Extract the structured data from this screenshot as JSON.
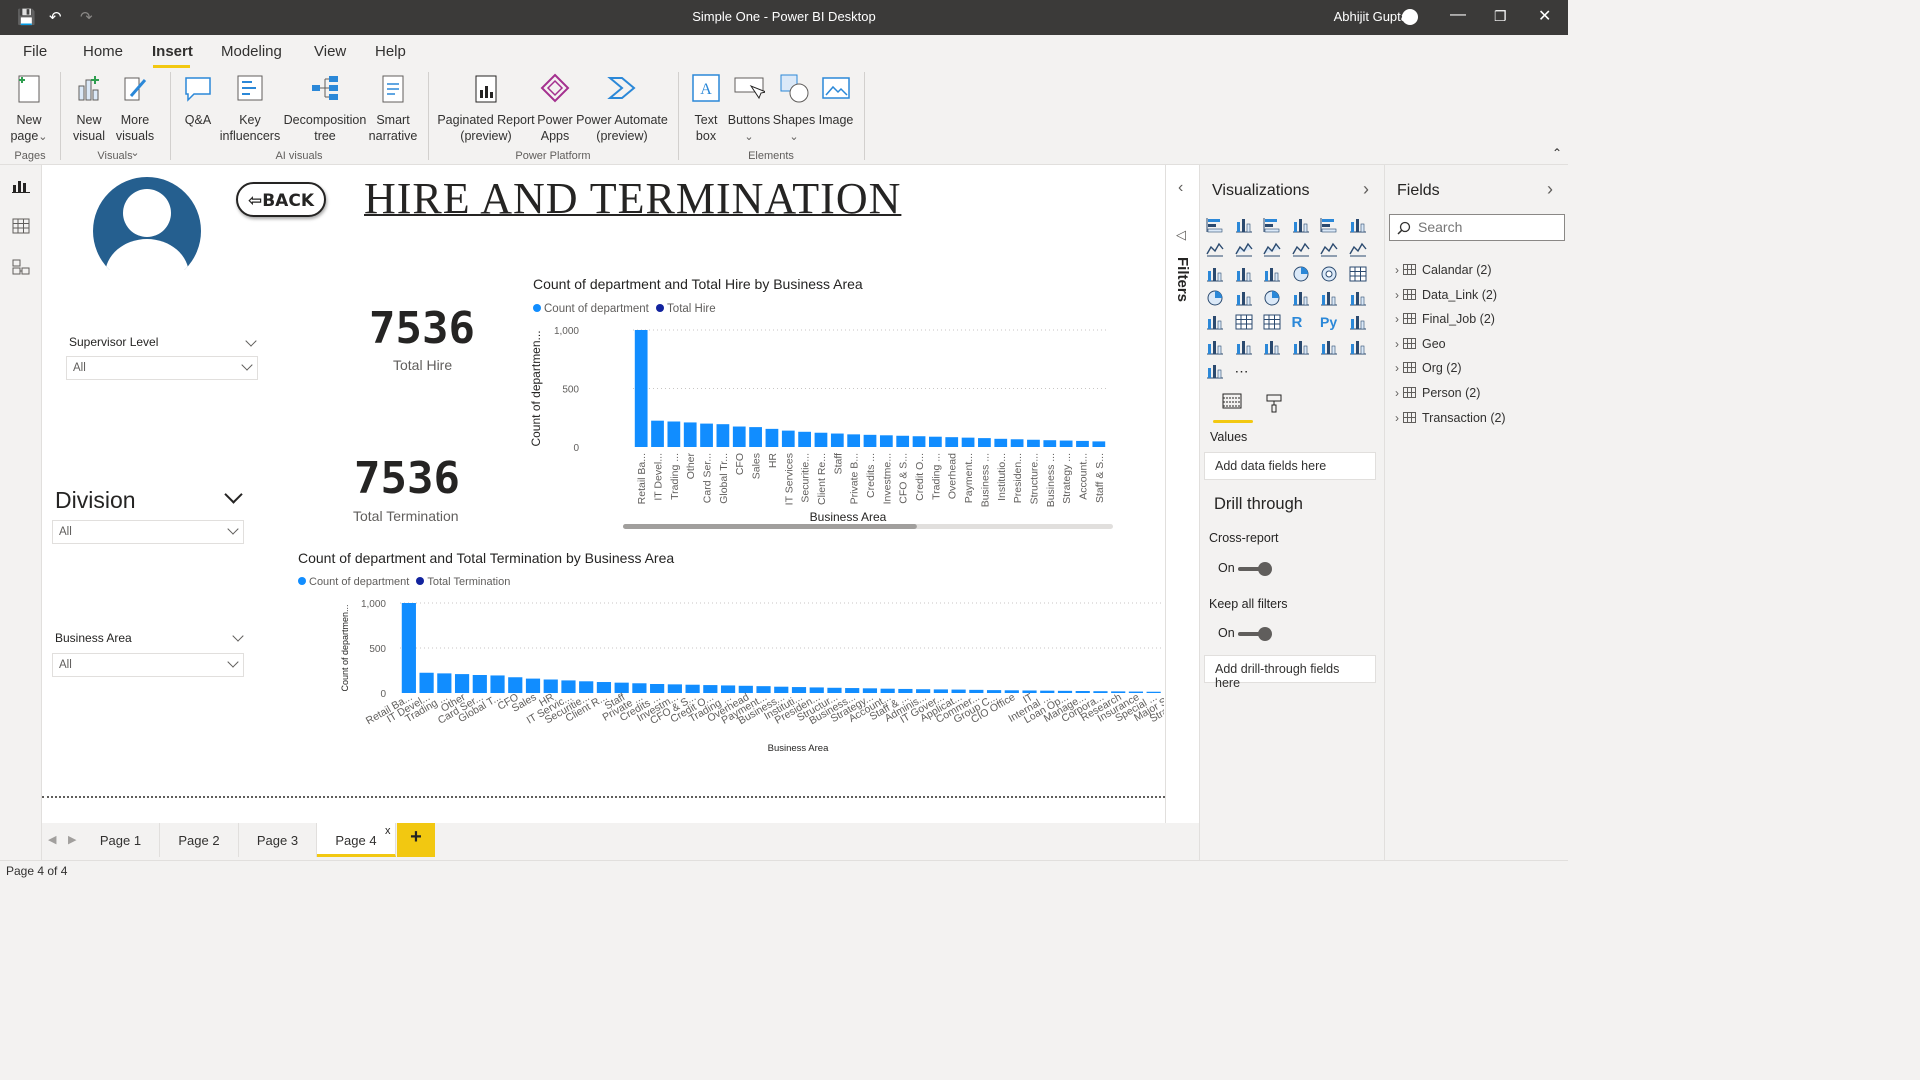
{
  "window": {
    "title": "Simple One - Power BI Desktop",
    "user": "Abhijit Gupta"
  },
  "menu": {
    "tabs": [
      "File",
      "Home",
      "Insert",
      "Modeling",
      "View",
      "Help"
    ],
    "active": "Insert"
  },
  "ribbon": {
    "buttons": {
      "new_page": [
        "New",
        "page"
      ],
      "new_visual": [
        "New",
        "visual"
      ],
      "more_visuals": [
        "More",
        "visuals"
      ],
      "qa": [
        "Q&A",
        ""
      ],
      "key_influencers": [
        "Key",
        "influencers"
      ],
      "decomposition_tree": [
        "Decomposition",
        "tree"
      ],
      "smart_narrative": [
        "Smart",
        "narrative"
      ],
      "paginated_report": [
        "Paginated Report",
        "(preview)"
      ],
      "power_apps": [
        "Power",
        "Apps"
      ],
      "power_automate": [
        "Power Automate",
        "(preview)"
      ],
      "text_box": [
        "Text",
        "box"
      ],
      "buttons": [
        "Buttons",
        ""
      ],
      "shapes": [
        "Shapes",
        ""
      ],
      "image": [
        "Image",
        ""
      ]
    },
    "groups": {
      "pages": "Pages",
      "visuals": "Visuals",
      "ai": "AI visuals",
      "platform": "Power Platform",
      "elements": "Elements"
    }
  },
  "canvas": {
    "back_button": "⇦BACK",
    "title": "HIRE AND TERMINATION",
    "card_hire": {
      "value": "7536",
      "label": "Total Hire"
    },
    "card_term": {
      "value": "7536",
      "label": "Total Termination"
    },
    "slicers": {
      "supervisor": {
        "label": "Supervisor Level",
        "value": "All"
      },
      "division": {
        "label": "Division",
        "value": "All"
      },
      "business_area": {
        "label": "Business Area",
        "value": "All"
      }
    }
  },
  "chart_data": [
    {
      "type": "bar",
      "title": "Count of department and Total Hire by Business Area",
      "legend": [
        "Count of department",
        "Total Hire"
      ],
      "xlabel": "Business Area",
      "ylabel": "Count of departmen...",
      "ylim": [
        0,
        1000
      ],
      "yticks": [
        "1,000",
        "500",
        "0"
      ],
      "categories": [
        "Retail Ba...",
        "IT Devel...",
        "Trading ...",
        "Other",
        "Card Ser...",
        "Global Tr...",
        "CFO",
        "Sales",
        "HR",
        "IT Services",
        "Securitie...",
        "Client Re...",
        "Staff",
        "Private B...",
        "Credits ...",
        "Investme...",
        "CFO & S...",
        "Credit O...",
        "Trading ...",
        "Overhead",
        "Payment...",
        "Business ...",
        "Institutio...",
        "Presiden...",
        "Structure...",
        "Business ...",
        "Strategy ...",
        "Account...",
        "Staff & S..."
      ],
      "values": [
        1000,
        225,
        218,
        210,
        200,
        195,
        175,
        170,
        155,
        140,
        130,
        122,
        115,
        108,
        104,
        100,
        96,
        92,
        88,
        84,
        80,
        76,
        70,
        66,
        62,
        58,
        55,
        52,
        48
      ],
      "series_colors": [
        "#118dff",
        "#12239e"
      ],
      "grid": true,
      "scrollbar": true
    },
    {
      "type": "bar",
      "title": "Count of department and Total Termination by Business Area",
      "legend": [
        "Count of department",
        "Total Termination"
      ],
      "xlabel": "Business Area",
      "ylabel": "Count of departmen...",
      "ylim": [
        0,
        1000
      ],
      "yticks": [
        "1,000",
        "500",
        "0"
      ],
      "categories": [
        "Retail Ba...",
        "IT Devel...",
        "Trading ...",
        "Other",
        "Card Ser...",
        "Global T...",
        "CFO",
        "Sales",
        "HR",
        "IT Servic...",
        "Securitie...",
        "Client R...",
        "Staff",
        "Private ...",
        "Credits ...",
        "Investm...",
        "CFO & S...",
        "Credit O...",
        "Trading ...",
        "Overhead",
        "Payment...",
        "Business...",
        "Instituti...",
        "Presiden...",
        "Structur...",
        "Business...",
        "Strategy...",
        "Account...",
        "Staff & ...",
        "Adminis...",
        "IT Gover...",
        "Applicat...",
        "Commer...",
        "Group C...",
        "CIO Office",
        "IT",
        "Internal ...",
        "Loan Op...",
        "Manage...",
        "Corpora...",
        "Research",
        "Insurance",
        "Special ...",
        "Major S...",
        "Strategy..."
      ],
      "values": [
        1000,
        225,
        218,
        210,
        200,
        195,
        175,
        160,
        150,
        140,
        130,
        122,
        115,
        108,
        100,
        96,
        92,
        88,
        84,
        80,
        76,
        70,
        66,
        62,
        58,
        55,
        52,
        48,
        45,
        42,
        40,
        38,
        35,
        32,
        30,
        28,
        26,
        24,
        22,
        20,
        18,
        16,
        14,
        12,
        10
      ],
      "series_colors": [
        "#118dff",
        "#12239e"
      ],
      "grid": true
    }
  ],
  "pages": {
    "tabs": [
      "Page 1",
      "Page 2",
      "Page 3",
      "Page 4"
    ],
    "active": "Page 4",
    "add": "+"
  },
  "status": "Page 4 of 4",
  "filters_label": "Filters",
  "visualizations": {
    "header": "Visualizations",
    "values_label": "Values",
    "values_well": "Add data fields here",
    "drill_header": "Drill through",
    "cross_report": "Cross-report",
    "cross_report_state": "On",
    "keep_filters": "Keep all filters",
    "keep_filters_state": "On",
    "drill_well": "Add drill-through fields here"
  },
  "fields_pane": {
    "header": "Fields",
    "search_placeholder": "Search",
    "tables": [
      "Calandar (2)",
      "Data_Link (2)",
      "Final_Job (2)",
      "Geo",
      "Org (2)",
      "Person (2)",
      "Transaction (2)"
    ]
  }
}
